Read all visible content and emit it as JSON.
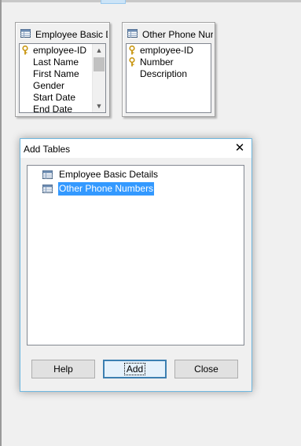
{
  "colors": {
    "accent": "#3399ff",
    "key": "#d4a017",
    "dialog_border": "#6fb8e0"
  },
  "tables": [
    {
      "title": "Employee Basic D",
      "icon": "table-icon",
      "rows": [
        {
          "label": "employee-ID",
          "is_key": true
        },
        {
          "label": "Last Name",
          "is_key": false
        },
        {
          "label": "First Name",
          "is_key": false
        },
        {
          "label": "Gender",
          "is_key": false
        },
        {
          "label": "Start Date",
          "is_key": false
        },
        {
          "label": "End Date",
          "is_key": false
        }
      ]
    },
    {
      "title": "Other Phone Nur",
      "icon": "table-icon",
      "rows": [
        {
          "label": "employee-ID",
          "is_key": true
        },
        {
          "label": "Number",
          "is_key": true
        },
        {
          "label": "Description",
          "is_key": false
        }
      ]
    }
  ],
  "dialog": {
    "title": "Add Tables",
    "items": [
      {
        "label": "Employee Basic Details",
        "selected": false
      },
      {
        "label": "Other Phone Numbers",
        "selected": true
      }
    ],
    "buttons": {
      "help": "Help",
      "add": "Add",
      "close": "Close"
    }
  }
}
